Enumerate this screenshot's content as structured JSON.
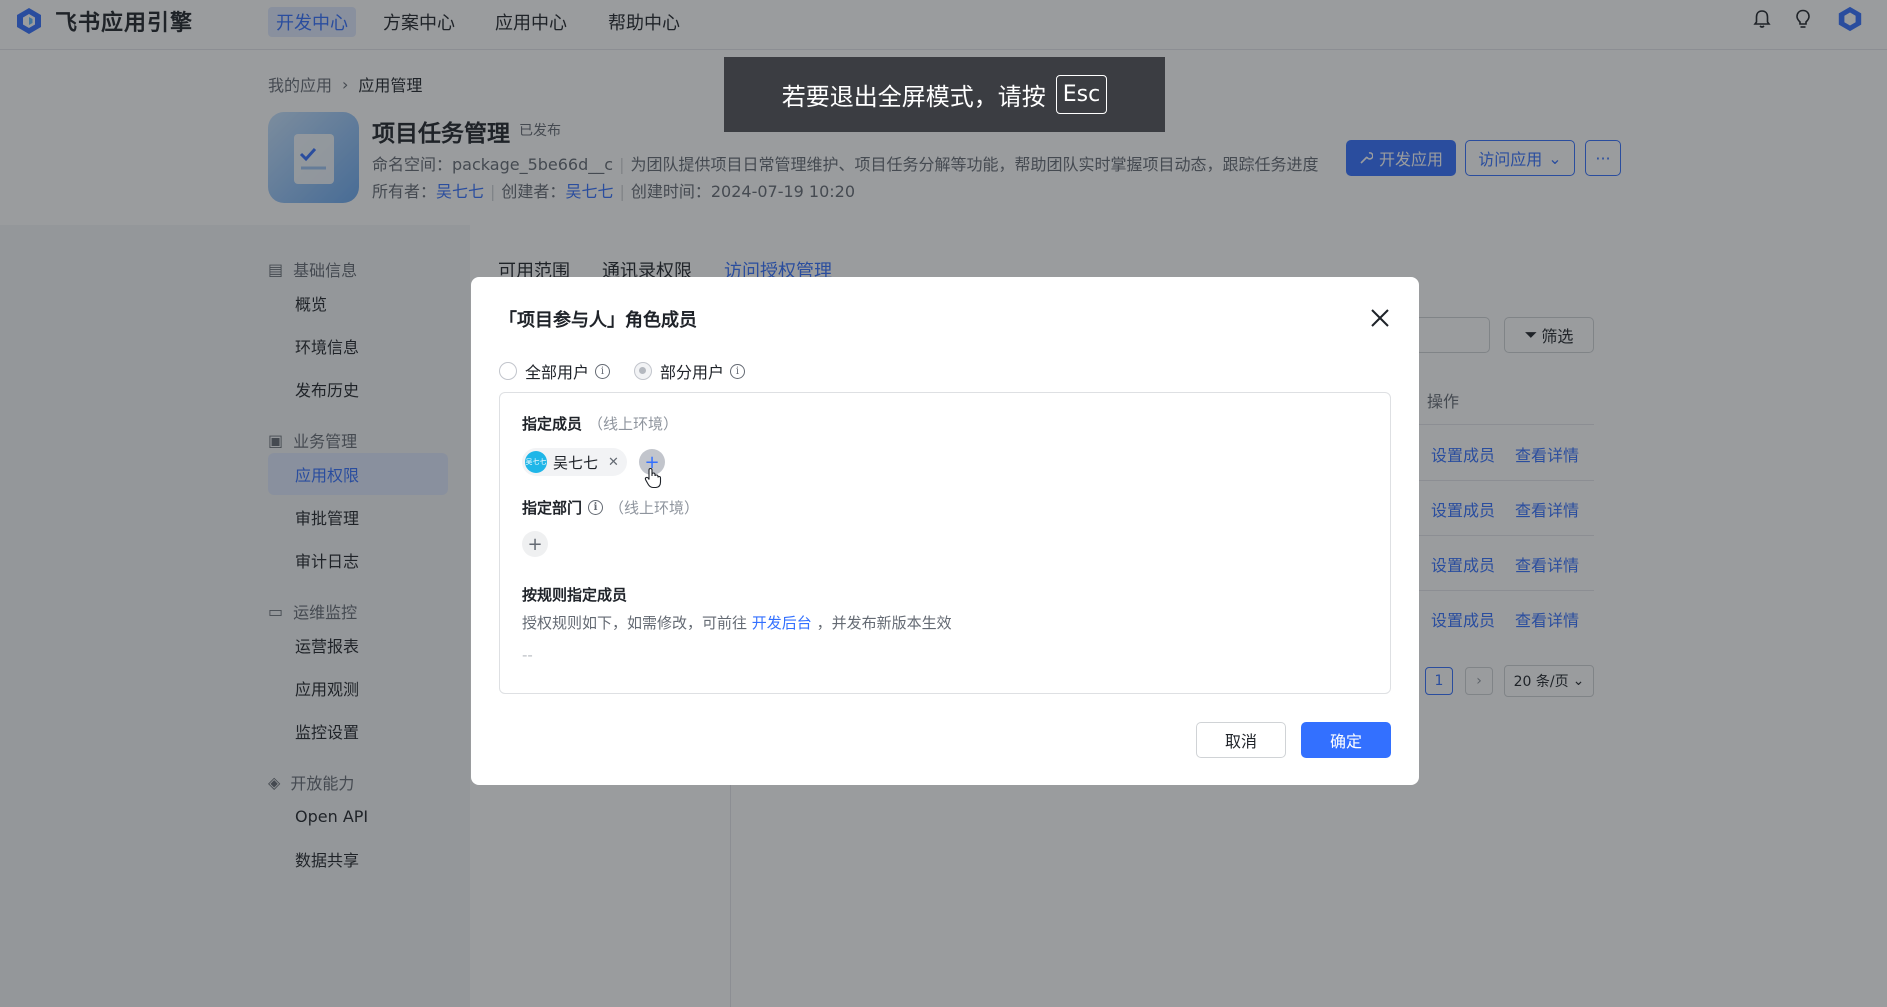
{
  "topnav": {
    "brand": "飞书应用引擎",
    "items": [
      {
        "label": "开发中心"
      },
      {
        "label": "方案中心"
      },
      {
        "label": "应用中心"
      },
      {
        "label": "帮助中心"
      }
    ],
    "icons": [
      "bell-icon",
      "lightbulb-icon",
      "brand-avatar-icon"
    ]
  },
  "breadcrumb": {
    "root": "我的应用",
    "current": "应用管理"
  },
  "app": {
    "title": "项目任务管理",
    "status": "已发布",
    "namespace_label": "命名空间：",
    "namespace": "package_5be66d__c",
    "description": "为团队提供项目日常管理维护、项目任务分解等功能，帮助团队实时掌握项目动态，跟踪任务进度",
    "owner_label": "所有者：",
    "owner": "吴七七",
    "creator_label": "创建者：",
    "creator": "吴七七",
    "created_label": "创建时间：",
    "created_at": "2024-07-19 10:20",
    "btn_develop": "开发应用",
    "btn_visit": "访问应用",
    "btn_more": "···"
  },
  "sidebar": {
    "groups": [
      {
        "label": "基础信息",
        "items": [
          {
            "label": "概览"
          },
          {
            "label": "环境信息"
          },
          {
            "label": "发布历史"
          }
        ]
      },
      {
        "label": "业务管理",
        "items": [
          {
            "label": "应用权限"
          },
          {
            "label": "审批管理"
          },
          {
            "label": "审计日志"
          }
        ]
      },
      {
        "label": "运维监控",
        "items": [
          {
            "label": "运营报表"
          },
          {
            "label": "应用观测"
          },
          {
            "label": "监控设置"
          }
        ]
      },
      {
        "label": "开放能力",
        "items": [
          {
            "label": "Open API"
          },
          {
            "label": "数据共享"
          }
        ]
      }
    ]
  },
  "main": {
    "tabs": [
      {
        "label": "可用范围"
      },
      {
        "label": "通讯录权限"
      },
      {
        "label": "访问授权管理"
      }
    ],
    "filter_label": "筛选",
    "op_header": "操作",
    "row_action_set": "设置成员",
    "row_action_view": "查看详情",
    "page_current": "1",
    "page_size": "20 条/页"
  },
  "fullscreen_toast": {
    "text": "若要退出全屏模式，请按",
    "key": "Esc"
  },
  "modal": {
    "title": "「项目参与人」角色成员",
    "option_all": "全部用户",
    "option_partial": "部分用户",
    "selected_option": "部分用户",
    "members_label": "指定成员",
    "members_env": "（线上环境）",
    "member_chip": {
      "name": "吴七七",
      "avatar_text": "吴七七"
    },
    "depts_label": "指定部门",
    "depts_env": "（线上环境）",
    "rule_label": "按规则指定成员",
    "rule_desc_before": "授权规则如下，如需修改，可前往 ",
    "rule_link": "开发后台",
    "rule_desc_after": " ，并发布新版本生效",
    "rule_empty": "--",
    "cancel": "取消",
    "ok": "确定"
  },
  "colors": {
    "accent": "#3370ff",
    "accent_light": "#e1eaff",
    "text": "#1f2329",
    "muted": "#646a73"
  }
}
